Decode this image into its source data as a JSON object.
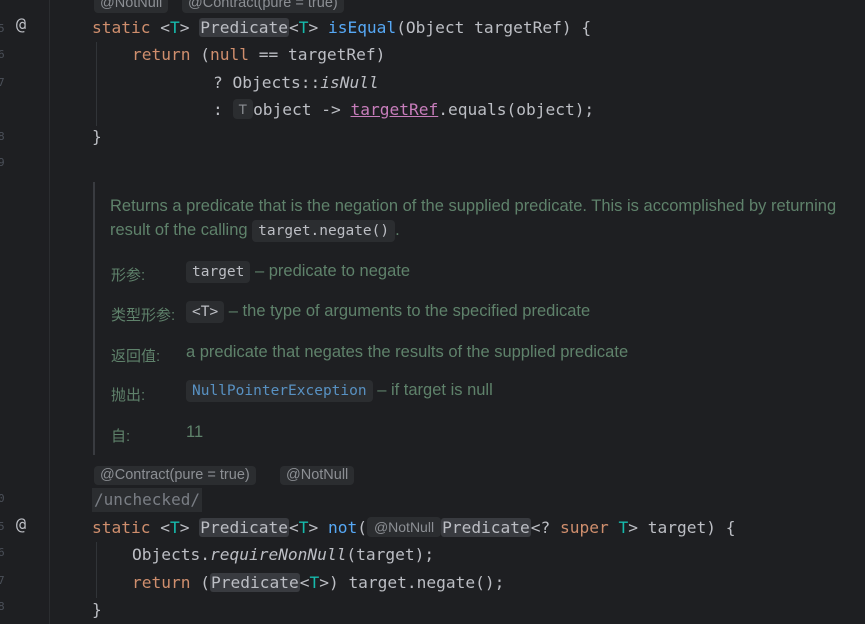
{
  "gutter": {
    "line_numbers": [
      "5",
      "6",
      "7",
      "8",
      "9",
      "0",
      "5",
      "6",
      "7",
      "8",
      "9"
    ],
    "markers": [
      "@",
      "@"
    ]
  },
  "top_hints": {
    "not_null": "@NotNull",
    "contract": "@Contract(pure = true)"
  },
  "method1": {
    "line1": {
      "static": "static",
      "tparam_open": "<",
      "tparam": "T",
      "tparam_close": ">",
      "ret_type": "Predicate",
      "ret_lt": "<",
      "ret_t": "T",
      "ret_gt": ">",
      "name": "isEqual",
      "params": "(Object targetRef) {"
    },
    "line2": {
      "return": "return",
      "open": "(",
      "null": "null",
      "rest": " == targetRef)"
    },
    "line3": {
      "q": "? Objects::",
      "isnull": "isNull"
    },
    "line4": {
      "colon": ": ",
      "type_hint": "T",
      "obj": "object -> ",
      "field": "targetRef",
      "rest": ".equals(object);"
    },
    "close": "}"
  },
  "javadoc": {
    "desc_line1": "Returns a predicate that is the negation of the supplied predicate. This is accomplished by returning",
    "desc_line2_pre": "result of the calling ",
    "desc_code": "target.negate()",
    "desc_line2_post": ".",
    "params_label": "形参:",
    "param_name": "target",
    "param_desc": "– predicate to negate",
    "type_params_label": "类型形参:",
    "type_param": "<T>",
    "type_param_desc": "– the type of arguments to the specified predicate",
    "returns_label": "返回值:",
    "returns_desc": "a predicate that negates the results of the supplied predicate",
    "throws_label": "抛出:",
    "throws_exc": "NullPointerException",
    "throws_desc": "– if target is null",
    "since_label": "自:",
    "since_value": "11"
  },
  "annotations2": {
    "contract": "@Contract(pure = true)",
    "not_null": "@NotNull"
  },
  "comment": "/unchecked/",
  "method2": {
    "line1": {
      "static": "static",
      "tparam": "T",
      "ret_type": "Predicate",
      "name": "not",
      "paren": "(",
      "hint": "@NotNull",
      "param_type": "Predicate",
      "wild": "<? ",
      "super": "super",
      "tvar": "T",
      "rest": "> target) {"
    },
    "line2": {
      "objects": "Objects.",
      "req": "requireNonNull",
      "rest": "(target);"
    },
    "line3": {
      "return": "return",
      "open": "(",
      "type": "Predicate",
      "lt": "<",
      "t": "T",
      "rest": ">) target.negate();"
    },
    "close": "}"
  },
  "colors": {
    "background": "#1e1f22",
    "keyword": "#cf8e6d",
    "type_param": "#16baac",
    "function": "#56a8f5",
    "doc": "#5f826b",
    "field": "#c77dbb"
  }
}
